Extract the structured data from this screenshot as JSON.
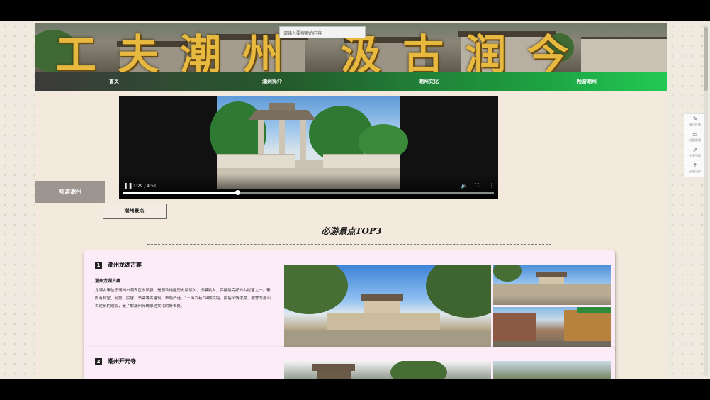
{
  "header": {
    "title": "工夫潮州 汲古润今",
    "search_placeholder": "请输入要搜索的内容"
  },
  "nav": {
    "items": [
      "首页",
      "潮州简介",
      "潮州文化",
      "畅游潮州"
    ]
  },
  "video": {
    "time": "1:29 / 4:51",
    "progress": 0.307
  },
  "sidebar": {
    "label": "畅游潮州",
    "subtab": "潮州景点"
  },
  "section": {
    "title": "必游景点TOP3"
  },
  "cards": [
    {
      "num": "1",
      "title": "潮州龙湖古寨",
      "subtitle": "潮州龙湖古寨",
      "body": "龙湖古寨位于潮州市潮安区东凤镇，是潮汕地区历史最悠久、规模最大、保存最完好的古村落之一。寨内有祠堂、府第、民居、书斋等古建筑，布局严谨，“三街六巷”纵横交错，民俗风情浓厚，被誉为潮汕古建筑的缩影，是了解潮州传统聚落文化的好去处。"
    },
    {
      "num": "2",
      "title": "潮州开元寺"
    }
  ],
  "toolbar": {
    "items": [
      {
        "icon": "pencil-icon",
        "label": "意见反馈"
      },
      {
        "icon": "monitor-icon",
        "label": "适配屏幕"
      },
      {
        "icon": "share-icon",
        "label": "分享页面"
      },
      {
        "icon": "arrow-up-icon",
        "label": "回到顶部"
      }
    ]
  },
  "colors": {
    "nav_start": "#3c3a3a",
    "nav_end": "#22c955",
    "title_gold": "#e8b93f",
    "card_bg": "#fcecf7",
    "page_bg": "#f3e9dd"
  }
}
